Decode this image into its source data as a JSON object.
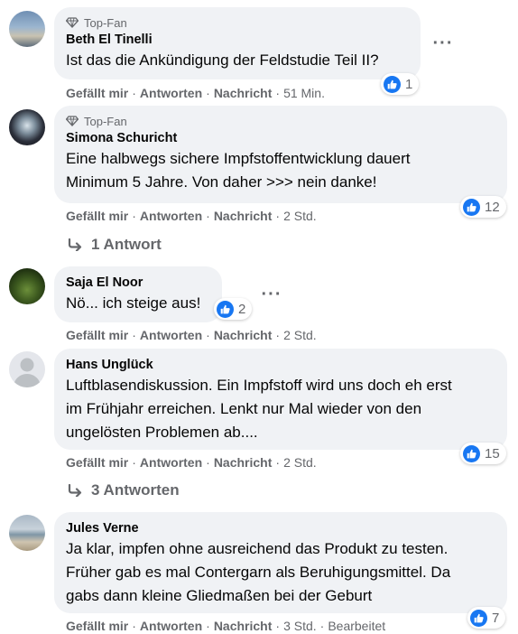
{
  "comments": [
    {
      "badge": "Top-Fan",
      "author": "Beth El Tinelli",
      "lines": [
        "Ist das die Ankündigung der Feldstudie Teil II?"
      ],
      "reactions": "1",
      "actions": {
        "like": "Gefällt mir",
        "reply": "Antworten",
        "message": "Nachricht",
        "time": "51 Min."
      }
    },
    {
      "badge": "Top-Fan",
      "author": "Simona Schuricht",
      "lines": [
        "Eine halbwegs sichere Impfstoffentwicklung dauert",
        "Minimum 5 Jahre. Von daher >>> nein danke!"
      ],
      "reactions": "12",
      "actions": {
        "like": "Gefällt mir",
        "reply": "Antworten",
        "message": "Nachricht",
        "time": "2 Std."
      },
      "replies": "1 Antwort"
    },
    {
      "author": "Saja El Noor",
      "lines": [
        "Nö... ich steige aus!"
      ],
      "reactions": "2",
      "actions": {
        "like": "Gefällt mir",
        "reply": "Antworten",
        "message": "Nachricht",
        "time": "2 Std."
      }
    },
    {
      "author": "Hans Unglück",
      "lines": [
        "Luftblasendiskussion. Ein Impfstoff wird uns doch eh erst",
        "im Frühjahr erreichen. Lenkt nur Mal wieder von den",
        "ungelösten Problemen ab...."
      ],
      "reactions": "15",
      "actions": {
        "like": "Gefällt mir",
        "reply": "Antworten",
        "message": "Nachricht",
        "time": "2 Std."
      },
      "replies": "3 Antworten"
    },
    {
      "author": "Jules Verne",
      "lines": [
        "Ja klar, impfen ohne ausreichend das Produkt zu testen.",
        "Früher gab es mal Contergarn als Beruhigungsmittel. Da",
        "gabs dann kleine Gliedmaßen bei der Geburt"
      ],
      "reactions": "7",
      "actions": {
        "like": "Gefällt mir",
        "reply": "Antworten",
        "message": "Nachricht",
        "time": "3 Std.",
        "edited": "Bearbeitet"
      }
    }
  ],
  "colors": {
    "bubble": "#f0f2f5",
    "like_blue": "#1877f2",
    "meta": "#65676b"
  }
}
